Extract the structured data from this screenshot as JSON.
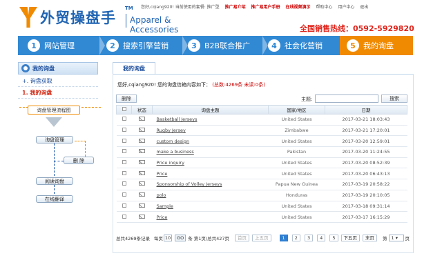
{
  "header": {
    "logo_cn": "外贸操盘手",
    "logo_tm": "TM",
    "logo_en": "Apparel & Accessories",
    "top_links": [
      {
        "text": "您好,cqiang920! 当前使用的套餐: 推广型",
        "style": "gray"
      },
      {
        "text": "推广易介绍",
        "style": "red"
      },
      {
        "text": "推广易用户手册",
        "style": "red"
      },
      {
        "text": "在线视频演示",
        "style": "red"
      },
      {
        "text": "帮助中心",
        "style": "gray"
      },
      {
        "text": "用户中心",
        "style": "gray"
      },
      {
        "text": "退出",
        "style": "gray"
      }
    ],
    "hotline": "全国销售热线：0592-5929820"
  },
  "nav": [
    {
      "num": "1",
      "label": "网站管理"
    },
    {
      "num": "2",
      "label": "搜索引擎营销"
    },
    {
      "num": "3",
      "label": "B2B联合推广"
    },
    {
      "num": "4",
      "label": "社会化营销"
    },
    {
      "num": "5",
      "label": "我的询盘"
    }
  ],
  "sidebar": {
    "title": "我的询盘",
    "items": [
      "+. 询盘获取",
      "1. 我的询盘"
    ]
  },
  "flow": {
    "title": "询盘管理流程图",
    "manage": "询盘管理",
    "delete": "删 除",
    "read": "阅读询盘",
    "translate": "在线翻译"
  },
  "main": {
    "tab": "我的询盘",
    "greeting": "您好,cqiang920! 您的询盘信箱内容如下：",
    "counts": "(总数:4269条  未读:0条)",
    "delete_button": "删除",
    "subject_label": "主题:",
    "subject_value": "",
    "search_button": "搜索",
    "columns": [
      "",
      "状态",
      "询盘主题",
      "国家/地区",
      "日期"
    ],
    "rows": [
      {
        "subject": "Basketball Jerseys",
        "country": "United States",
        "date": "2017-03-21 18:03:43"
      },
      {
        "subject": "Rugby Jersey",
        "country": "Zimbabwe",
        "date": "2017-03-21 17:20:01"
      },
      {
        "subject": "custom design",
        "country": "United States",
        "date": "2017-03-20 12:59:01"
      },
      {
        "subject": "make a business",
        "country": "Pakistan",
        "date": "2017-03-20 11:24:55"
      },
      {
        "subject": "Price inquiry",
        "country": "United States",
        "date": "2017-03-20 08:52:39"
      },
      {
        "subject": "Price",
        "country": "United States",
        "date": "2017-03-20 06:43:13"
      },
      {
        "subject": "Sponsorship of Volley Jerseys",
        "country": "Papua New Guinea",
        "date": "2017-03-19 20:58:22"
      },
      {
        "subject": "polo",
        "country": "Honduras",
        "date": "2017-03-19 20:10:05"
      },
      {
        "subject": "Sample",
        "country": "United States",
        "date": "2017-03-18 09:31:14"
      },
      {
        "subject": "Price",
        "country": "United States",
        "date": "2017-03-17 16:15:29"
      }
    ]
  },
  "pager": {
    "total": "总共4269条记录",
    "per_page_label": "每页",
    "per_page_value": "10",
    "go": "GO",
    "page_info": "条 第1页/总共427页",
    "first": "首页",
    "prev": "上五页",
    "pages": [
      "1",
      "2",
      "3",
      "4",
      "5"
    ],
    "next": "下五页",
    "last": "末页",
    "jump_label": "第",
    "jump_value": "1",
    "jump_unit": "页"
  },
  "colors": {
    "brand_blue": "#3189d4",
    "active_orange": "#f08a00",
    "hotline_red": "#e0241b"
  }
}
